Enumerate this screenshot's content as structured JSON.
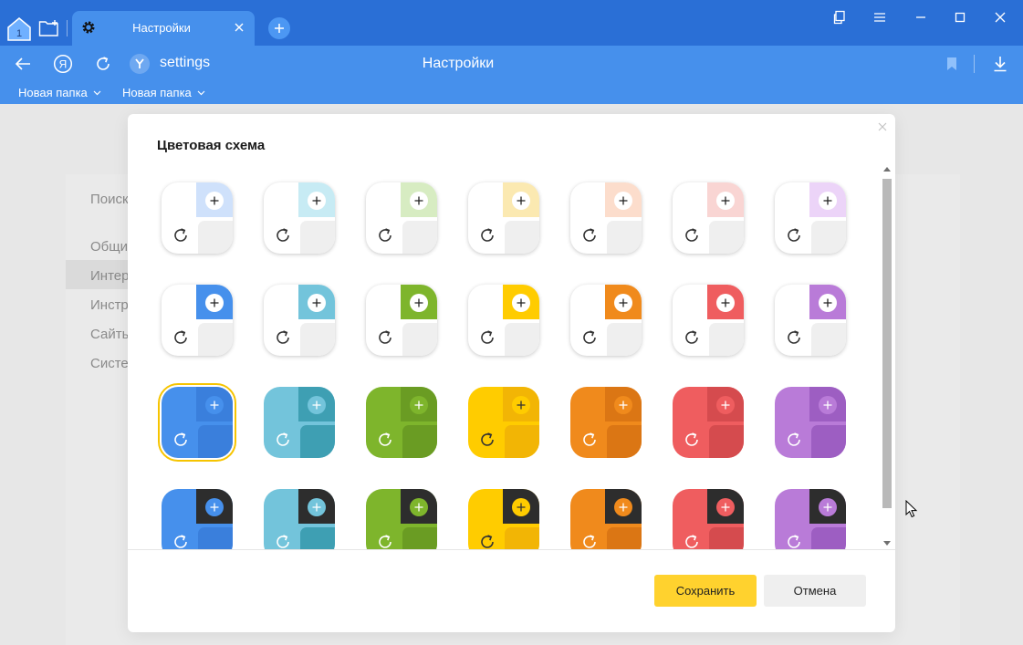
{
  "browser": {
    "tab_badge": "1",
    "tab_title": "Настройки",
    "address": "settings",
    "page_title": "Настройки",
    "bookmarks": [
      "Новая папка",
      "Новая папка"
    ]
  },
  "settings_page": {
    "search_placeholder": "Поиск",
    "nav": [
      "Общи",
      "Интер",
      "Инстр",
      "Сайты",
      "Систе"
    ]
  },
  "dialog": {
    "title": "Цветовая схема",
    "save_label": "Сохранить",
    "cancel_label": "Отмена",
    "selected": "row3-col1"
  },
  "colors": {
    "titlebar": "#2a6fd6",
    "toolbar": "#4690ec",
    "selection": "#f6c400",
    "save_button": "#ffd22e"
  },
  "palette": {
    "pastel": [
      "#cfe1fb",
      "#c7ebf4",
      "#d7ecc2",
      "#fbe9b1",
      "#fcddcc",
      "#f9d5d3",
      "#ecd4f8"
    ],
    "color": [
      "#4690ec",
      "#73c4db",
      "#7eb52c",
      "#ffcc00",
      "#f08a1c",
      "#ef5d5f",
      "#b97bd8"
    ],
    "color_dark": [
      "#3a7fdc",
      "#3e9fb3",
      "#6a9c23",
      "#f2b505",
      "#db7614",
      "#d54b4e",
      "#9d5ec2"
    ],
    "dark_band": "#2d2d2d"
  },
  "icons": {
    "refresh": "refresh-icon",
    "plus": "plus-icon"
  }
}
